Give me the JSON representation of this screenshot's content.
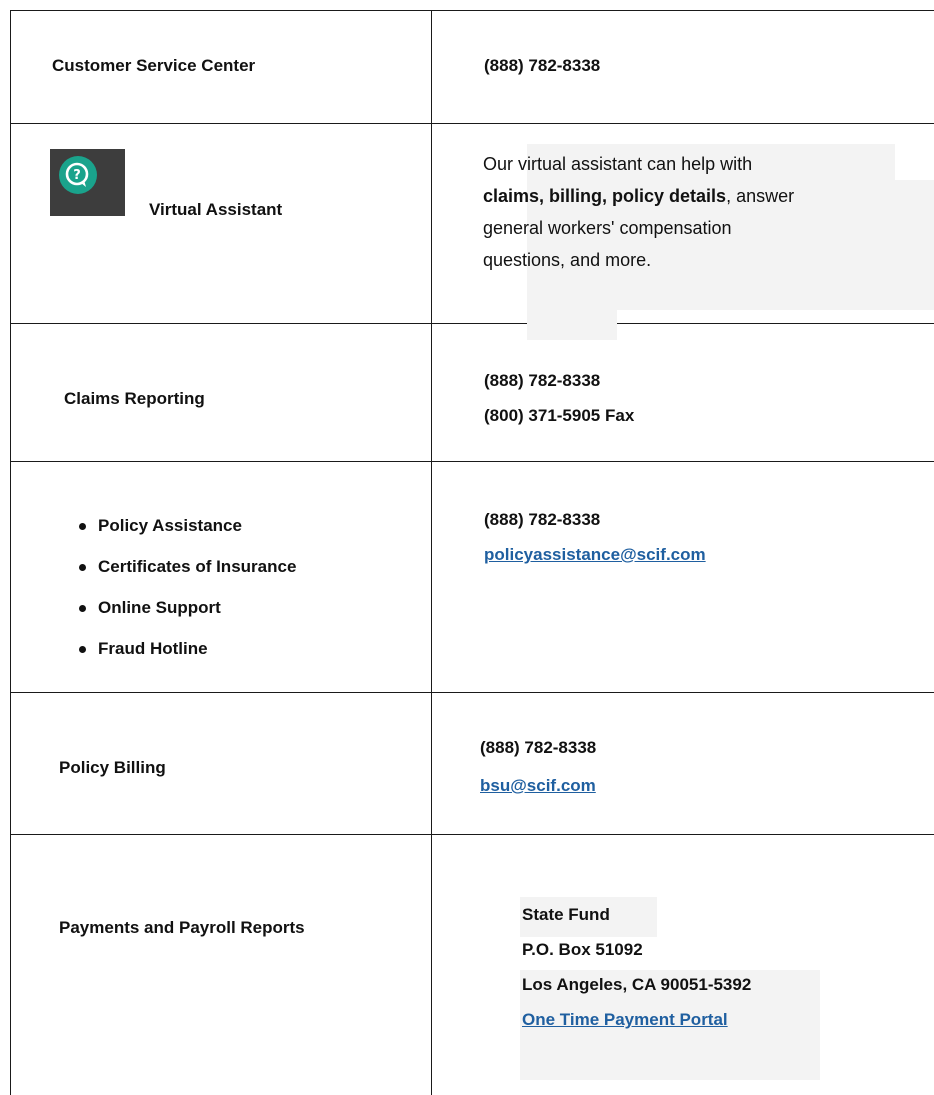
{
  "rows": {
    "customer_service": {
      "label": "Customer Service Center",
      "phone": "(888) 782-8338"
    },
    "virtual_assistant": {
      "label": "Virtual Assistant",
      "desc_line1": "Our virtual assistant can help with",
      "desc_bold": "claims, billing, policy details",
      "desc_line2_rest": ", answer",
      "desc_line3": "general workers' compensation",
      "desc_line4": "questions, and more."
    },
    "claims_reporting": {
      "label": "Claims Reporting",
      "phone": "(888) 782-8338",
      "fax": "(800) 371-5905 Fax"
    },
    "policy_assistance": {
      "items": [
        "Policy Assistance",
        "Certificates of Insurance",
        "Online Support",
        "Fraud Hotline"
      ],
      "phone": "(888) 782-8338",
      "email": "policyassistance@scif.com"
    },
    "policy_billing": {
      "label": "Policy Billing",
      "phone": "(888) 782-8338",
      "email": "bsu@scif.com"
    },
    "payments": {
      "label": "Payments and Payroll Reports",
      "addr1": "State Fund",
      "addr2": "P.O. Box 51092",
      "addr3": "Los Angeles, CA 90051-5392",
      "portal_link": "One Time Payment Portal"
    }
  },
  "icons": {
    "virtual_assistant": "chat-question-icon"
  },
  "colors": {
    "link": "#1f5fa0",
    "icon_bg": "#3d3d3d",
    "icon_accent": "#1aa38c"
  }
}
